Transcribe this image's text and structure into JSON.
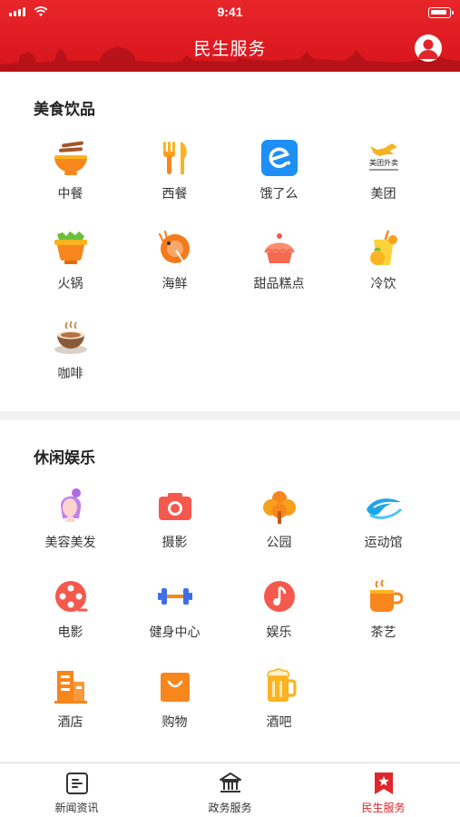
{
  "status_bar": {
    "time": "9:41"
  },
  "header": {
    "title": "民生服务"
  },
  "food": {
    "title": "美食饮品",
    "items": [
      {
        "label": "中餐",
        "icon": "noodle-bowl-icon"
      },
      {
        "label": "西餐",
        "icon": "fork-knife-icon"
      },
      {
        "label": "饿了么",
        "icon": "eleme-logo-icon"
      },
      {
        "label": "美团",
        "icon": "meituan-logo-icon",
        "logo_text": "美团外卖"
      },
      {
        "label": "火锅",
        "icon": "hotpot-icon"
      },
      {
        "label": "海鲜",
        "icon": "shrimp-icon"
      },
      {
        "label": "甜品糕点",
        "icon": "cake-icon"
      },
      {
        "label": "冷饮",
        "icon": "cold-drink-icon"
      },
      {
        "label": "咖啡",
        "icon": "coffee-cup-icon"
      }
    ]
  },
  "leisure": {
    "title": "休闲娱乐",
    "items": [
      {
        "label": "美容美发",
        "icon": "beauty-icon"
      },
      {
        "label": "摄影",
        "icon": "camera-icon"
      },
      {
        "label": "公园",
        "icon": "tree-icon"
      },
      {
        "label": "运动馆",
        "icon": "wave-icon"
      },
      {
        "label": "电影",
        "icon": "film-reel-icon"
      },
      {
        "label": "健身中心",
        "icon": "dumbbell-icon"
      },
      {
        "label": "娱乐",
        "icon": "music-note-icon"
      },
      {
        "label": "茶艺",
        "icon": "tea-cup-icon"
      },
      {
        "label": "酒店",
        "icon": "hotel-building-icon"
      },
      {
        "label": "购物",
        "icon": "shopping-bag-icon"
      },
      {
        "label": "酒吧",
        "icon": "beer-mug-icon"
      }
    ]
  },
  "tabs": [
    {
      "label": "新闻资讯",
      "icon": "news-icon",
      "active": false
    },
    {
      "label": "政务服务",
      "icon": "government-building-icon",
      "active": false
    },
    {
      "label": "民生服务",
      "icon": "bookmark-star-icon",
      "active": true
    }
  ],
  "colors": {
    "header": "#e0262a",
    "active_tab": "#e0262a",
    "orange": "#f7861c",
    "yellow": "#fbb31f"
  }
}
